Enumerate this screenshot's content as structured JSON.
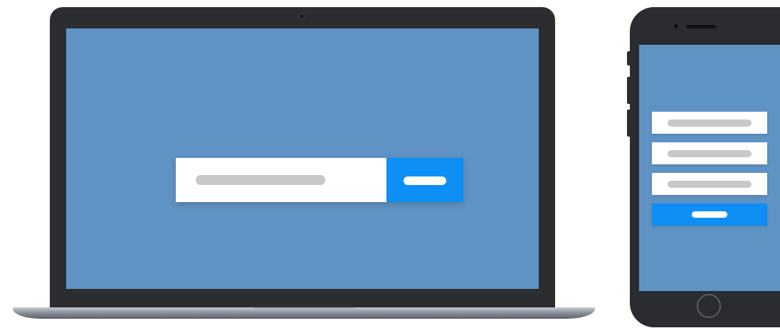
{
  "laptop": {
    "screen_color": "#5f93c4",
    "search_form": {
      "input_value": "",
      "input_placeholder": "",
      "submit_label": ""
    }
  },
  "phone": {
    "screen_color": "#5f93c4",
    "form": {
      "fields": [
        {
          "value": "",
          "placeholder": ""
        },
        {
          "value": "",
          "placeholder": ""
        },
        {
          "value": "",
          "placeholder": ""
        }
      ],
      "submit_label": ""
    }
  },
  "colors": {
    "device_frame": "#2b2d31",
    "accent_button": "#0e8ff5",
    "input_background": "#ffffff",
    "placeholder_bar": "#c8c8c8"
  }
}
